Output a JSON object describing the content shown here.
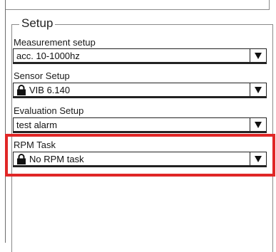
{
  "setup": {
    "title": "Setup",
    "fields": [
      {
        "label": "Measurement setup",
        "value": "acc. 10-1000hz",
        "locked": false
      },
      {
        "label": "Sensor Setup",
        "value": "VIB 6.140",
        "locked": true
      },
      {
        "label": "Evaluation Setup",
        "value": "test alarm",
        "locked": false
      },
      {
        "label": "RPM Task",
        "value": "No RPM task",
        "locked": true
      }
    ]
  },
  "icons": {
    "lock": "lock-icon",
    "dropdown": "dropdown-arrow-icon"
  },
  "colors": {
    "highlight": "#e02727",
    "border": "#222222"
  }
}
